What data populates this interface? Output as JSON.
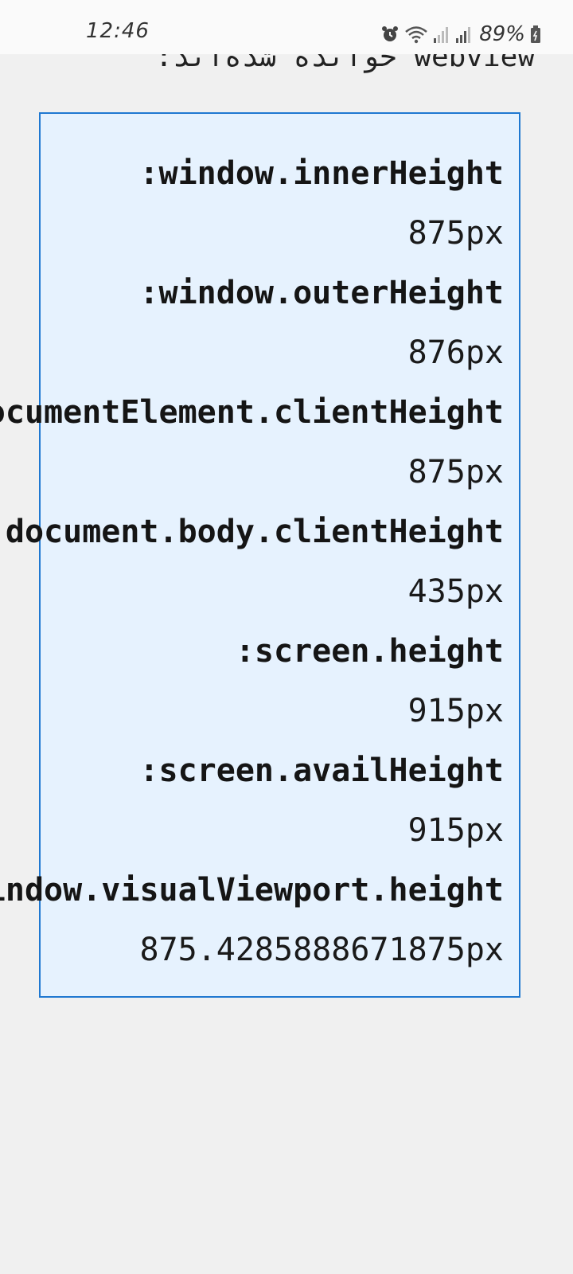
{
  "status_bar": {
    "time": "12:46",
    "battery_percent": "89%",
    "icons": [
      "alarm-icon",
      "wifi-icon",
      "signal-icon",
      "signal-icon",
      "battery-icon"
    ]
  },
  "page": {
    "intro_text": "webview خوانده شده‌اند:",
    "metrics": [
      {
        "label": "window.innerHeight:",
        "value": "875px"
      },
      {
        "label": "window.outerHeight:",
        "value": "876px"
      },
      {
        "label": "document.documentElement.clientHeight:",
        "value": "875px"
      },
      {
        "label": "document.body.clientHeight:",
        "value": "435px"
      },
      {
        "label": "screen.height:",
        "value": "915px"
      },
      {
        "label": "screen.availHeight:",
        "value": "915px"
      },
      {
        "label": "window.visualViewport.height:",
        "value": "875.4285888671875px"
      }
    ]
  },
  "colors": {
    "box_background": "#e6f2fe",
    "box_border": "#1f78d1",
    "page_background": "#f0f0f0"
  }
}
